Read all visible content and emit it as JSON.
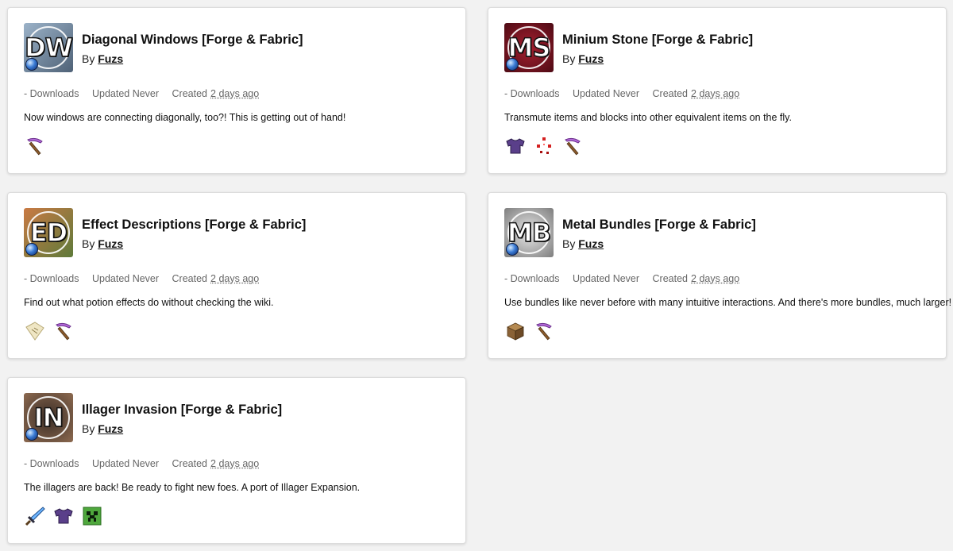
{
  "mods": [
    {
      "logo": "DW",
      "logo_colors": [
        "#8fa6bd",
        "#53677c"
      ],
      "title": "Diagonal Windows [Forge & Fabric]",
      "by": "By",
      "author": "Fuzs",
      "downloads": "- Downloads",
      "updated": "Updated Never",
      "created_prefix": "Created",
      "created_date": "2 days ago",
      "summary": "Now windows are connecting diagonally, too?! This is getting out of hand!",
      "categories": [
        "pickaxe-icon"
      ]
    },
    {
      "logo": "MS",
      "logo_colors": [
        "#9a1c2c",
        "#5a0d18"
      ],
      "title": "Minium Stone [Forge & Fabric]",
      "by": "By",
      "author": "Fuzs",
      "downloads": "- Downloads",
      "updated": "Updated Never",
      "created_prefix": "Created",
      "created_date": "2 days ago",
      "summary": "Transmute items and blocks into other equivalent items on the fly.",
      "categories": [
        "armor-icon",
        "redstone-icon",
        "pickaxe-icon"
      ]
    },
    {
      "logo": "ED",
      "logo_colors": [
        "#b86a3a",
        "#6d4a2a"
      ],
      "title": "Effect Descriptions [Forge & Fabric]",
      "by": "By",
      "author": "Fuzs",
      "downloads": "- Downloads",
      "updated": "Updated Never",
      "created_prefix": "Created",
      "created_date": "2 days ago",
      "summary": "Find out what potion effects do without checking the wiki.",
      "categories": [
        "map-icon",
        "pickaxe-icon"
      ]
    },
    {
      "logo": "MB",
      "logo_colors": [
        "#d9d9d9",
        "#8a8a8a"
      ],
      "title": "Metal Bundles [Forge & Fabric]",
      "by": "By",
      "author": "Fuzs",
      "downloads": "- Downloads",
      "updated": "Updated Never",
      "created_prefix": "Created",
      "created_date": "2 days ago",
      "summary": "Use bundles like never before with many intuitive interactions. And there's more bundles, much larger!",
      "categories": [
        "chest-icon",
        "pickaxe-icon"
      ]
    },
    {
      "logo": "IN",
      "logo_colors": [
        "#8a6a54",
        "#2e2420"
      ],
      "title": "Illager Invasion [Forge & Fabric]",
      "by": "By",
      "author": "Fuzs",
      "downloads": "- Downloads",
      "updated": "Updated Never",
      "created_prefix": "Created",
      "created_date": "2 days ago",
      "summary": "The illagers are back! Be ready to fight new foes. A port of Illager Expansion.",
      "categories": [
        "sword-icon",
        "armor-icon",
        "creeper-icon"
      ]
    }
  ]
}
